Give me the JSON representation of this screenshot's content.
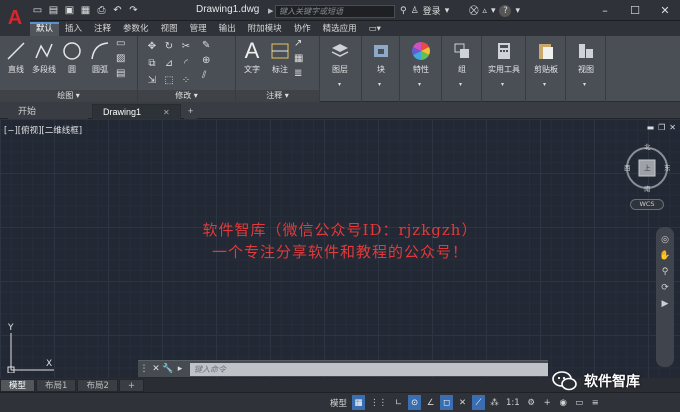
{
  "app": {
    "logo_text": "A",
    "doc_title": "Drawing1.dwg",
    "search_placeholder": "键入关键字或短语",
    "login_label": "登录",
    "help_label": "?"
  },
  "qat": {
    "icons": [
      "new-file-icon",
      "open-icon",
      "save-icon",
      "saveas-icon",
      "print-icon",
      "undo-icon",
      "redo-icon"
    ]
  },
  "ribbon_tabs": [
    {
      "label": "默认",
      "active": true
    },
    {
      "label": "插入"
    },
    {
      "label": "注释"
    },
    {
      "label": "参数化"
    },
    {
      "label": "视图"
    },
    {
      "label": "管理"
    },
    {
      "label": "输出"
    },
    {
      "label": "附加模块"
    },
    {
      "label": "协作"
    },
    {
      "label": "精选应用"
    },
    {
      "label": "▭▾"
    }
  ],
  "ribbon": {
    "draw": {
      "title": "绘图",
      "line": "直线",
      "polyline": "多段线",
      "circle": "圆",
      "arc": "圆弧"
    },
    "modify": {
      "title": "修改"
    },
    "annotation": {
      "title": "注释",
      "text": "文字",
      "dim": "标注"
    },
    "layers": "图层",
    "block": "块",
    "properties": "特性",
    "groups": "组",
    "utilities": "实用工具",
    "clipboard": "剪贴板",
    "view": "视图"
  },
  "doc_tabs": {
    "start": "开始",
    "drawing": "Drawing1",
    "add": "+"
  },
  "viewport": {
    "label": "[−][俯视][二维线框]",
    "viewcube": {
      "n": "北",
      "s": "南",
      "e": "东",
      "w": "西",
      "top": "上"
    },
    "wcs": "WCS",
    "ucs_x": "X",
    "ucs_y": "Y"
  },
  "watermark": {
    "line1": "软件智库（微信公众号ID：rjzkgzh）",
    "line2": "一个专注分享软件和教程的公众号！"
  },
  "command": {
    "placeholder": "键入命令"
  },
  "layout_tabs": [
    {
      "label": "模型",
      "active": true
    },
    {
      "label": "布局1"
    },
    {
      "label": "布局2"
    },
    {
      "label": "+"
    }
  ],
  "status": {
    "model": "模型",
    "scale": "1:1",
    "items": [
      "模型",
      "▦",
      "⋮⋮",
      "∟",
      "⊙",
      "∠",
      "◻",
      "✕",
      "⟋",
      "⁂",
      "1:1",
      "⚙",
      "+",
      "◉",
      "▭",
      "≡"
    ]
  },
  "brand": {
    "wechat_name": "软件智库"
  }
}
